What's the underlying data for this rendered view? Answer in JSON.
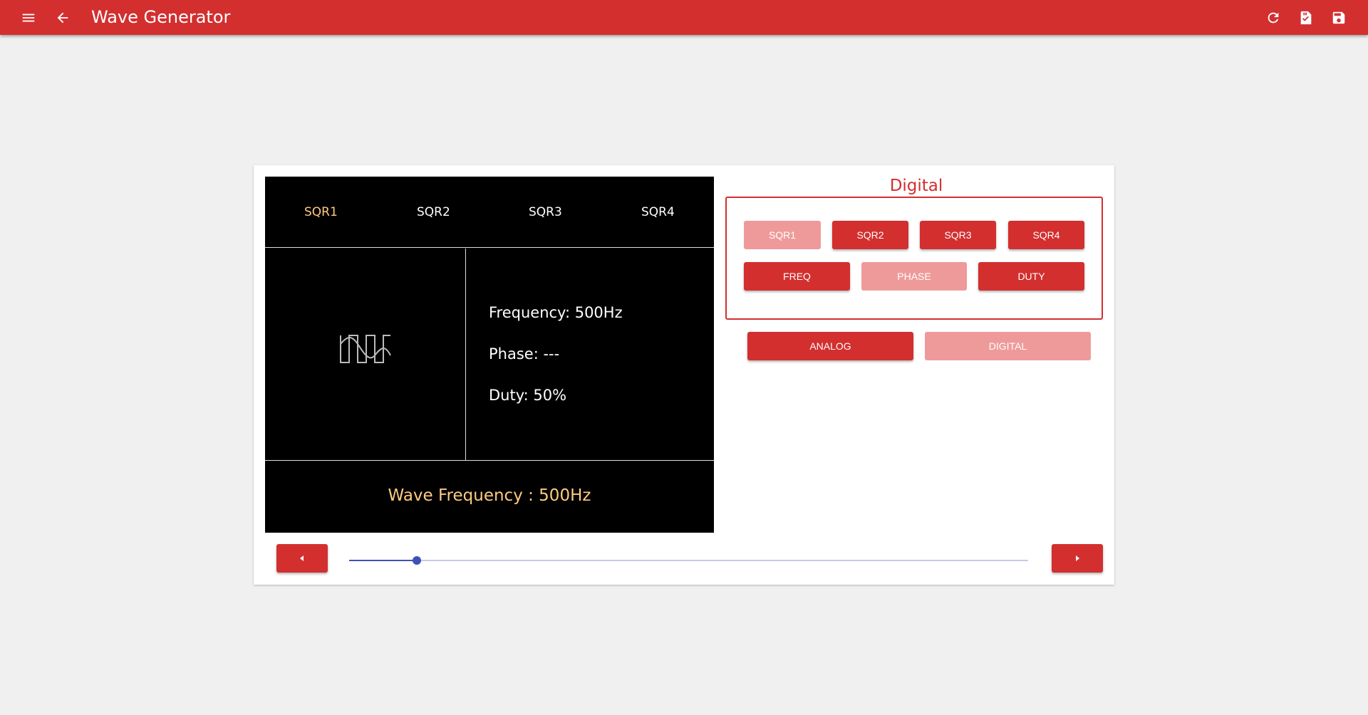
{
  "app": {
    "title": "Wave Generator",
    "accent": "#d32f2f",
    "icons": [
      "menu-icon",
      "arrow-back-icon",
      "refresh-icon",
      "sd-card-check-icon",
      "save-icon"
    ]
  },
  "display": {
    "tabs": [
      {
        "label": "SQR1",
        "active": true
      },
      {
        "label": "SQR2",
        "active": false
      },
      {
        "label": "SQR3",
        "active": false
      },
      {
        "label": "SQR4",
        "active": false
      }
    ],
    "wave_icon": "square-sine-wave-icon",
    "frequency": "Frequency: 500Hz",
    "phase": "Phase: ---",
    "duty": "Duty: 50%",
    "wave_frequency": "Wave Frequency : 500Hz",
    "highlight_color": "#ffcc80"
  },
  "panel": {
    "title": "Digital",
    "channel_buttons": [
      {
        "label": "SQR1",
        "disabled": true
      },
      {
        "label": "SQR2",
        "disabled": false
      },
      {
        "label": "SQR3",
        "disabled": false
      },
      {
        "label": "SQR4",
        "disabled": false
      }
    ],
    "param_buttons": [
      {
        "label": "FREQ",
        "disabled": false
      },
      {
        "label": "PHASE",
        "disabled": true
      },
      {
        "label": "DUTY",
        "disabled": false
      }
    ],
    "mode_buttons": [
      {
        "label": "ANALOG",
        "disabled": false
      },
      {
        "label": "DIGITAL",
        "disabled": true
      }
    ]
  },
  "slider": {
    "fraction": 0.1,
    "left_icon": "caret-left-icon",
    "right_icon": "caret-right-icon"
  }
}
